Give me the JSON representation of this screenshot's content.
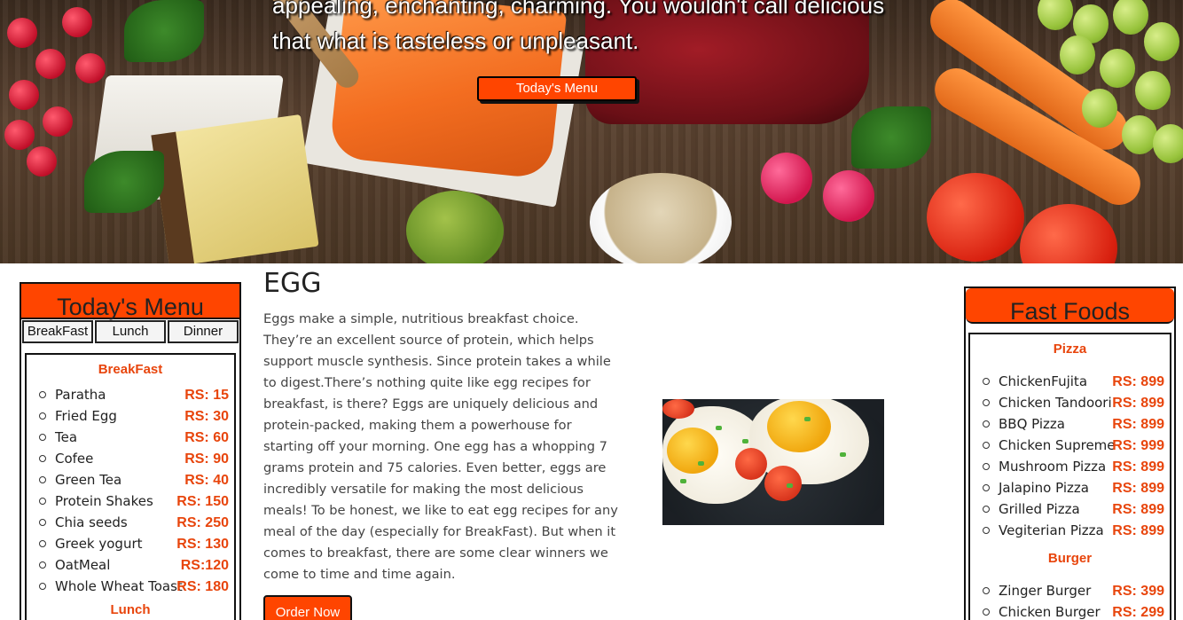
{
  "hero": {
    "text": "appealing, enchanting, charming. You wouldn't call delicious that what is tasteless or unpleasant.",
    "button": "Today's Menu"
  },
  "left_menu": {
    "title": "Today's Menu",
    "tabs": [
      "BreakFast",
      "Lunch",
      "Dinner"
    ],
    "breakfast": {
      "title": "BreakFast",
      "items": [
        {
          "name": "Paratha",
          "price": "RS: 15"
        },
        {
          "name": "Fried Egg",
          "price": "RS: 30"
        },
        {
          "name": "Tea",
          "price": "RS: 60"
        },
        {
          "name": "Cofee",
          "price": "RS: 90"
        },
        {
          "name": "Green Tea",
          "price": "RS: 40"
        },
        {
          "name": "Protein Shakes",
          "price": "RS: 150"
        },
        {
          "name": "Chia seeds",
          "price": "RS: 250"
        },
        {
          "name": "Greek yogurt",
          "price": "RS: 130"
        },
        {
          "name": "OatMeal",
          "price": "RS:120"
        },
        {
          "name": "Whole Wheat Toast",
          "price": "RS: 180"
        }
      ]
    },
    "next_section_title": "Lunch"
  },
  "center": {
    "title": "EGG",
    "body": "Eggs make a simple, nutritious breakfast choice. They’re an excellent source of protein, which helps support muscle synthesis. Since protein takes a while to digest.There’s nothing quite like egg recipes for breakfast, is there? Eggs are uniquely delicious and protein-packed, making them a powerhouse for starting off your morning. One egg has a whopping 7 grams protein and 75 calories. Even better, eggs are incredibly versatile for making the most delicious meals! To be honest, we like to eat egg recipes for any meal of the day (especially for BreakFast). But when it comes to breakfast, there are some clear winners we come to time and time again.",
    "order_button": "Order Now"
  },
  "fast_foods": {
    "title": "Fast Foods",
    "pizza": {
      "title": "Pizza",
      "items": [
        {
          "name": "ChickenFujita",
          "price": "RS: 899"
        },
        {
          "name": "Chicken Tandoori",
          "price": "RS: 899"
        },
        {
          "name": "BBQ Pizza",
          "price": "RS: 899"
        },
        {
          "name": "Chicken Supreme",
          "price": "RS: 999"
        },
        {
          "name": "Mushroom Pizza",
          "price": "RS: 899"
        },
        {
          "name": "Jalapino Pizza",
          "price": "RS: 899"
        },
        {
          "name": "Grilled Pizza",
          "price": "RS: 899"
        },
        {
          "name": "Vegiterian Pizza",
          "price": "RS: 899"
        }
      ]
    },
    "burger": {
      "title": "Burger",
      "items": [
        {
          "name": "Zinger Burger",
          "price": "RS: 399"
        },
        {
          "name": "Chicken Burger",
          "price": "RS: 299"
        }
      ]
    }
  },
  "colors": {
    "accent": "#ff4500",
    "price": "#e8450c"
  }
}
